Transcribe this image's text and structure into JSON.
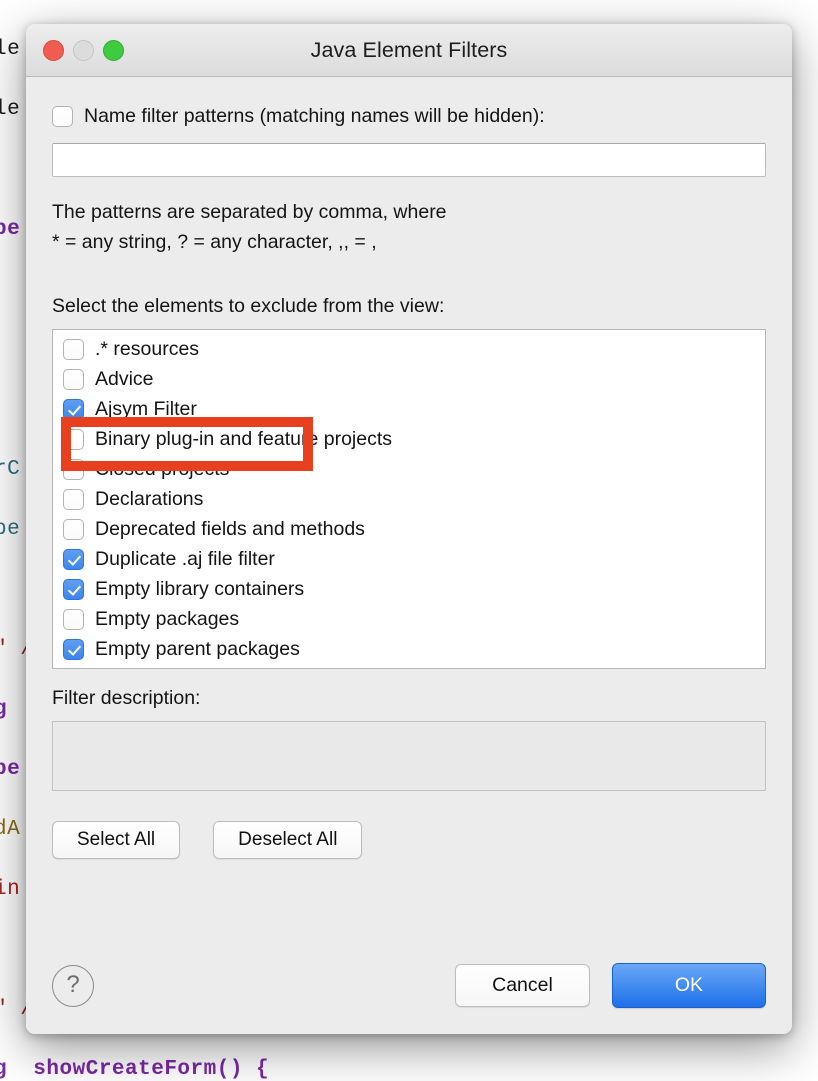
{
  "background_editor": {
    "lines": [
      "le",
      "le",
      "",
      "be",
      "",
      "",
      "",
      "rC",
      "be",
      "",
      "\" /",
      "g",
      "be",
      "dA",
      "in",
      "",
      "\" /",
      "g  showCreateForm() {"
    ]
  },
  "window": {
    "title": "Java Element Filters",
    "traffic_lights": [
      "close-button",
      "minimize-button",
      "zoom-button"
    ]
  },
  "name_filter": {
    "checkbox_label": "Name filter patterns (matching names will be hidden):",
    "checked": false,
    "input_value": "",
    "input_placeholder": "",
    "help_text": "The patterns are separated by comma, where\n* = any string, ? = any character, ,, = ,"
  },
  "exclude_section": {
    "label": "Select the elements to exclude from the view:",
    "items": [
      {
        "label": ".* resources",
        "checked": false
      },
      {
        "label": "Advice",
        "checked": false
      },
      {
        "label": "Ajsym Filter",
        "checked": true
      },
      {
        "label": "Binary plug-in and feature projects",
        "checked": false
      },
      {
        "label": "Closed projects",
        "checked": false
      },
      {
        "label": "Declarations",
        "checked": false
      },
      {
        "label": "Deprecated fields and methods",
        "checked": false
      },
      {
        "label": "Duplicate .aj file filter",
        "checked": true
      },
      {
        "label": "Empty library containers",
        "checked": true
      },
      {
        "label": "Empty packages",
        "checked": false
      },
      {
        "label": "Empty parent packages",
        "checked": true
      }
    ]
  },
  "filter_description": {
    "label": "Filter description:",
    "text": ""
  },
  "selection_buttons": {
    "select_all": "Select All",
    "deselect_all": "Deselect All"
  },
  "footer": {
    "help_icon": "?",
    "cancel": "Cancel",
    "ok": "OK"
  },
  "annotation": {
    "highlight_target": ".* resources",
    "color": "#e8401f"
  },
  "colors": {
    "accent_blue": "#3d86ee",
    "default_button": "#1d70e9",
    "annotation_red": "#e8401f",
    "window_bg": "#ececec",
    "titlebar_bg": "#e6e6e6"
  }
}
